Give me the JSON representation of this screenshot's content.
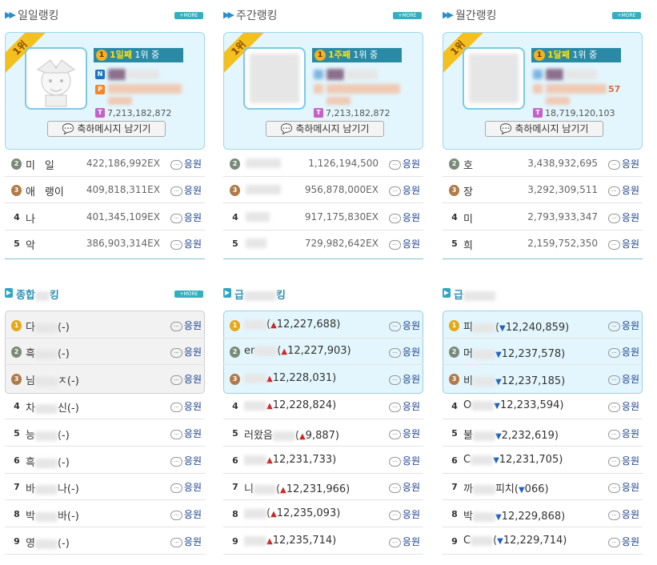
{
  "top_sections": [
    {
      "title": "일일랭킹",
      "more_label": "+MORE",
      "rank_badge": "1위",
      "champion": {
        "streak": "1일째",
        "text": "1위 중"
      },
      "points": "7,213,182,872",
      "extra": "",
      "congrats_label": "축하메시지 남기기",
      "rows": [
        {
          "rank": "2",
          "name": "미ㅤ일",
          "exp": "422,186,992EX",
          "cheer": "응원"
        },
        {
          "rank": "3",
          "name": "애ㅤ랭이",
          "exp": "409,818,311EX",
          "cheer": "응원"
        },
        {
          "rank": "4",
          "name": "나",
          "exp": "401,345,109EX",
          "cheer": "응원"
        },
        {
          "rank": "5",
          "name": "악",
          "exp": "386,903,314EX",
          "cheer": "응원"
        }
      ]
    },
    {
      "title": "주간랭킹",
      "more_label": "+MORE",
      "rank_badge": "1위",
      "champion": {
        "streak": "1주째",
        "text": "1위 중"
      },
      "points": "7,213,182,872",
      "extra": "",
      "congrats_label": "축하메시지 남기기",
      "rows": [
        {
          "rank": "2",
          "name": "",
          "exp": "1,126,194,500",
          "cheer": "응원"
        },
        {
          "rank": "3",
          "name": "",
          "exp": "956,878,000EX",
          "cheer": "응원"
        },
        {
          "rank": "4",
          "name": "",
          "exp": "917,175,830EX",
          "cheer": "응원"
        },
        {
          "rank": "5",
          "name": "",
          "exp": "729,982,642EX",
          "cheer": "응원"
        }
      ]
    },
    {
      "title": "월간랭킹",
      "more_label": "+MORE",
      "rank_badge": "1위",
      "champion": {
        "streak": "1달째",
        "text": "1위 중"
      },
      "points": "18,719,120,103",
      "extra": "57",
      "congrats_label": "축하메시지 남기기",
      "rows": [
        {
          "rank": "2",
          "name": "호",
          "exp": "3,438,932,695",
          "cheer": "응원"
        },
        {
          "rank": "3",
          "name": "장",
          "exp": "3,292,309,511",
          "cheer": "응원"
        },
        {
          "rank": "4",
          "name": "미",
          "exp": "2,793,933,347",
          "cheer": "응원"
        },
        {
          "rank": "5",
          "name": "희",
          "exp": "2,159,752,350",
          "cheer": "응원"
        }
      ]
    }
  ],
  "bottom_sections": [
    {
      "title": "종합",
      "title_suffix": "킹",
      "more_label": "+MORE",
      "rows": [
        {
          "rank": "1",
          "name": "다",
          "tail": "(-)",
          "dir": "",
          "cheer": "응원"
        },
        {
          "rank": "2",
          "name": "흑",
          "tail": "(-)",
          "dir": "",
          "cheer": "응원"
        },
        {
          "rank": "3",
          "name": "님",
          "tail": "ㅈ(-)",
          "dir": "",
          "cheer": "응원"
        },
        {
          "rank": "4",
          "name": "차",
          "tail": "신(-)",
          "dir": "",
          "cheer": "응원"
        },
        {
          "rank": "5",
          "name": "능",
          "tail": "(-)",
          "dir": "",
          "cheer": "응원"
        },
        {
          "rank": "6",
          "name": "흑",
          "tail": "(-)",
          "dir": "",
          "cheer": "응원"
        },
        {
          "rank": "7",
          "name": "바",
          "tail": "나(-)",
          "dir": "",
          "cheer": "응원"
        },
        {
          "rank": "8",
          "name": "박",
          "tail": "바(-)",
          "dir": "",
          "cheer": "응원"
        },
        {
          "rank": "9",
          "name": "영",
          "tail": "(-)",
          "dir": "",
          "cheer": "응원"
        }
      ]
    },
    {
      "title": "급",
      "title_suffix": "킹",
      "more_label": "",
      "rows": [
        {
          "rank": "1",
          "name": "",
          "tail": "12,227,688)",
          "prefix": "(",
          "dir": "up",
          "cheer": "응원"
        },
        {
          "rank": "2",
          "name": "er",
          "tail": "12,227,903)",
          "prefix": "(",
          "dir": "up",
          "cheer": "응원"
        },
        {
          "rank": "3",
          "name": "",
          "tail": "12,228,031)",
          "prefix": "",
          "dir": "up",
          "cheer": "응원"
        },
        {
          "rank": "4",
          "name": "",
          "tail": "12,228,824)",
          "prefix": "",
          "dir": "up",
          "cheer": "응원"
        },
        {
          "rank": "5",
          "name": "러왔음",
          "tail": "9,887)",
          "prefix": "(",
          "dir": "up",
          "cheer": "응원"
        },
        {
          "rank": "6",
          "name": "",
          "tail": "12,231,733)",
          "prefix": "",
          "dir": "up",
          "cheer": "응원"
        },
        {
          "rank": "7",
          "name": "니",
          "tail": "12,231,966)",
          "prefix": "(",
          "dir": "up",
          "cheer": "응원"
        },
        {
          "rank": "8",
          "name": "",
          "tail": "12,235,093)",
          "prefix": "(",
          "dir": "up",
          "cheer": "응원"
        },
        {
          "rank": "9",
          "name": "",
          "tail": "12,235,714)",
          "prefix": "",
          "dir": "up",
          "cheer": "응원"
        }
      ]
    },
    {
      "title": "급",
      "title_suffix": "",
      "more_label": "",
      "rows": [
        {
          "rank": "1",
          "name": "피",
          "tail": "12,240,859)",
          "prefix": "(",
          "dir": "down",
          "cheer": "응원"
        },
        {
          "rank": "2",
          "name": "머",
          "tail": "12,237,578)",
          "prefix": "",
          "dir": "down",
          "cheer": "응원"
        },
        {
          "rank": "3",
          "name": "비",
          "tail": "12,237,185)",
          "prefix": "",
          "dir": "down",
          "cheer": "응원"
        },
        {
          "rank": "4",
          "name": "O",
          "tail": "12,233,594)",
          "prefix": "",
          "dir": "down",
          "cheer": "응원"
        },
        {
          "rank": "5",
          "name": "불",
          "tail": "2,232,619)",
          "prefix": "",
          "dir": "down",
          "cheer": "응원"
        },
        {
          "rank": "6",
          "name": "C",
          "tail": "12,231,705)",
          "prefix": "",
          "dir": "down",
          "cheer": "응원"
        },
        {
          "rank": "7",
          "name": "까",
          "tail": "066)",
          "prefix": "피치(",
          "dir": "down",
          "cheer": "응원"
        },
        {
          "rank": "8",
          "name": "박",
          "tail": "12,229,868)",
          "prefix": "",
          "dir": "down",
          "cheer": "응원"
        },
        {
          "rank": "9",
          "name": "C",
          "tail": "12,229,714)",
          "prefix": "(",
          "dir": "down",
          "cheer": "응원"
        }
      ]
    }
  ],
  "colors": {
    "accent": "#2a8fc9",
    "champion_bar": "#2a8aa6",
    "cheer": "#1a3f8a",
    "up": "#d02626",
    "down": "#1d5fc2"
  },
  "icons": {
    "header_arrow": "double-chevron-right-icon",
    "speech": "speech-bubble-icon",
    "medal": "medal-icon"
  }
}
